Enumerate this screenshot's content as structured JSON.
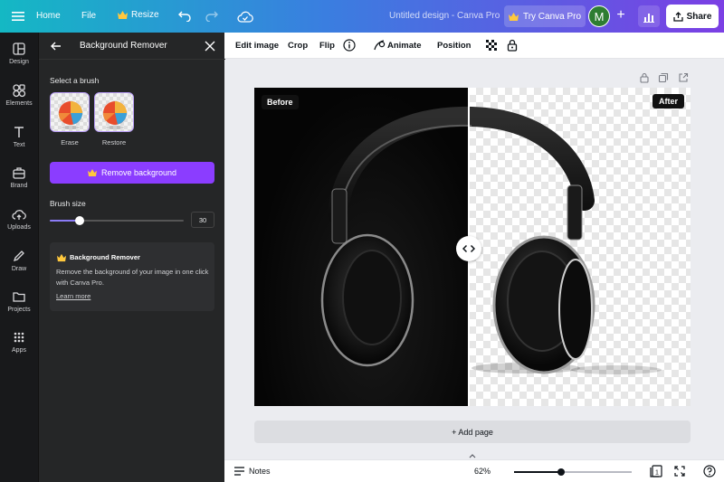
{
  "topbar": {
    "home": "Home",
    "file": "File",
    "resize": "Resize",
    "doc_title": "Untitled design - Canva Pro",
    "try_pro": "Try Canva Pro",
    "avatar_initial": "M",
    "share": "Share"
  },
  "rail": {
    "items": [
      {
        "label": "Design",
        "icon": "layout-icon"
      },
      {
        "label": "Elements",
        "icon": "shapes-icon"
      },
      {
        "label": "Text",
        "icon": "text-icon"
      },
      {
        "label": "Brand",
        "icon": "briefcase-icon"
      },
      {
        "label": "Uploads",
        "icon": "cloud-upload-icon"
      },
      {
        "label": "Draw",
        "icon": "pen-icon"
      },
      {
        "label": "Projects",
        "icon": "folder-icon"
      },
      {
        "label": "Apps",
        "icon": "grid-icon"
      }
    ]
  },
  "panel": {
    "title": "Background Remover",
    "select_brush": "Select a brush",
    "erase": "Erase",
    "restore": "Restore",
    "remove_bg": "Remove background",
    "brush_size": "Brush size",
    "brush_value": "30",
    "brush_fraction": 0.22,
    "info_title": "Background Remover",
    "info_body": "Remove the background of your image in one click with Canva Pro.",
    "info_link": "Learn more"
  },
  "toolbar": {
    "edit_image": "Edit image",
    "crop": "Crop",
    "flip": "Flip",
    "animate": "Animate",
    "position": "Position"
  },
  "canvas": {
    "before": "Before",
    "after": "After",
    "add_page": "+ Add page"
  },
  "bottombar": {
    "notes": "Notes",
    "zoom": "62%",
    "zoom_fraction": 0.4,
    "page_count": "1"
  },
  "colors": {
    "accent": "#8b3dff",
    "panel_bg": "#252627",
    "rail_bg": "#18191b"
  }
}
